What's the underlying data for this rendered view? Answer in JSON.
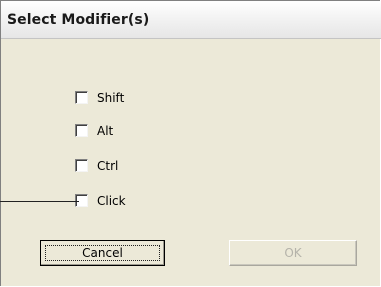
{
  "dialog": {
    "title": "Select Modifier(s)",
    "checkboxes": [
      {
        "label": "Shift",
        "checked": false
      },
      {
        "label": "Alt",
        "checked": false
      },
      {
        "label": "Ctrl",
        "checked": false
      },
      {
        "label": "Click",
        "checked": false
      }
    ],
    "buttons": {
      "cancel_label": "Cancel",
      "ok_label": "OK",
      "ok_enabled": false
    }
  }
}
